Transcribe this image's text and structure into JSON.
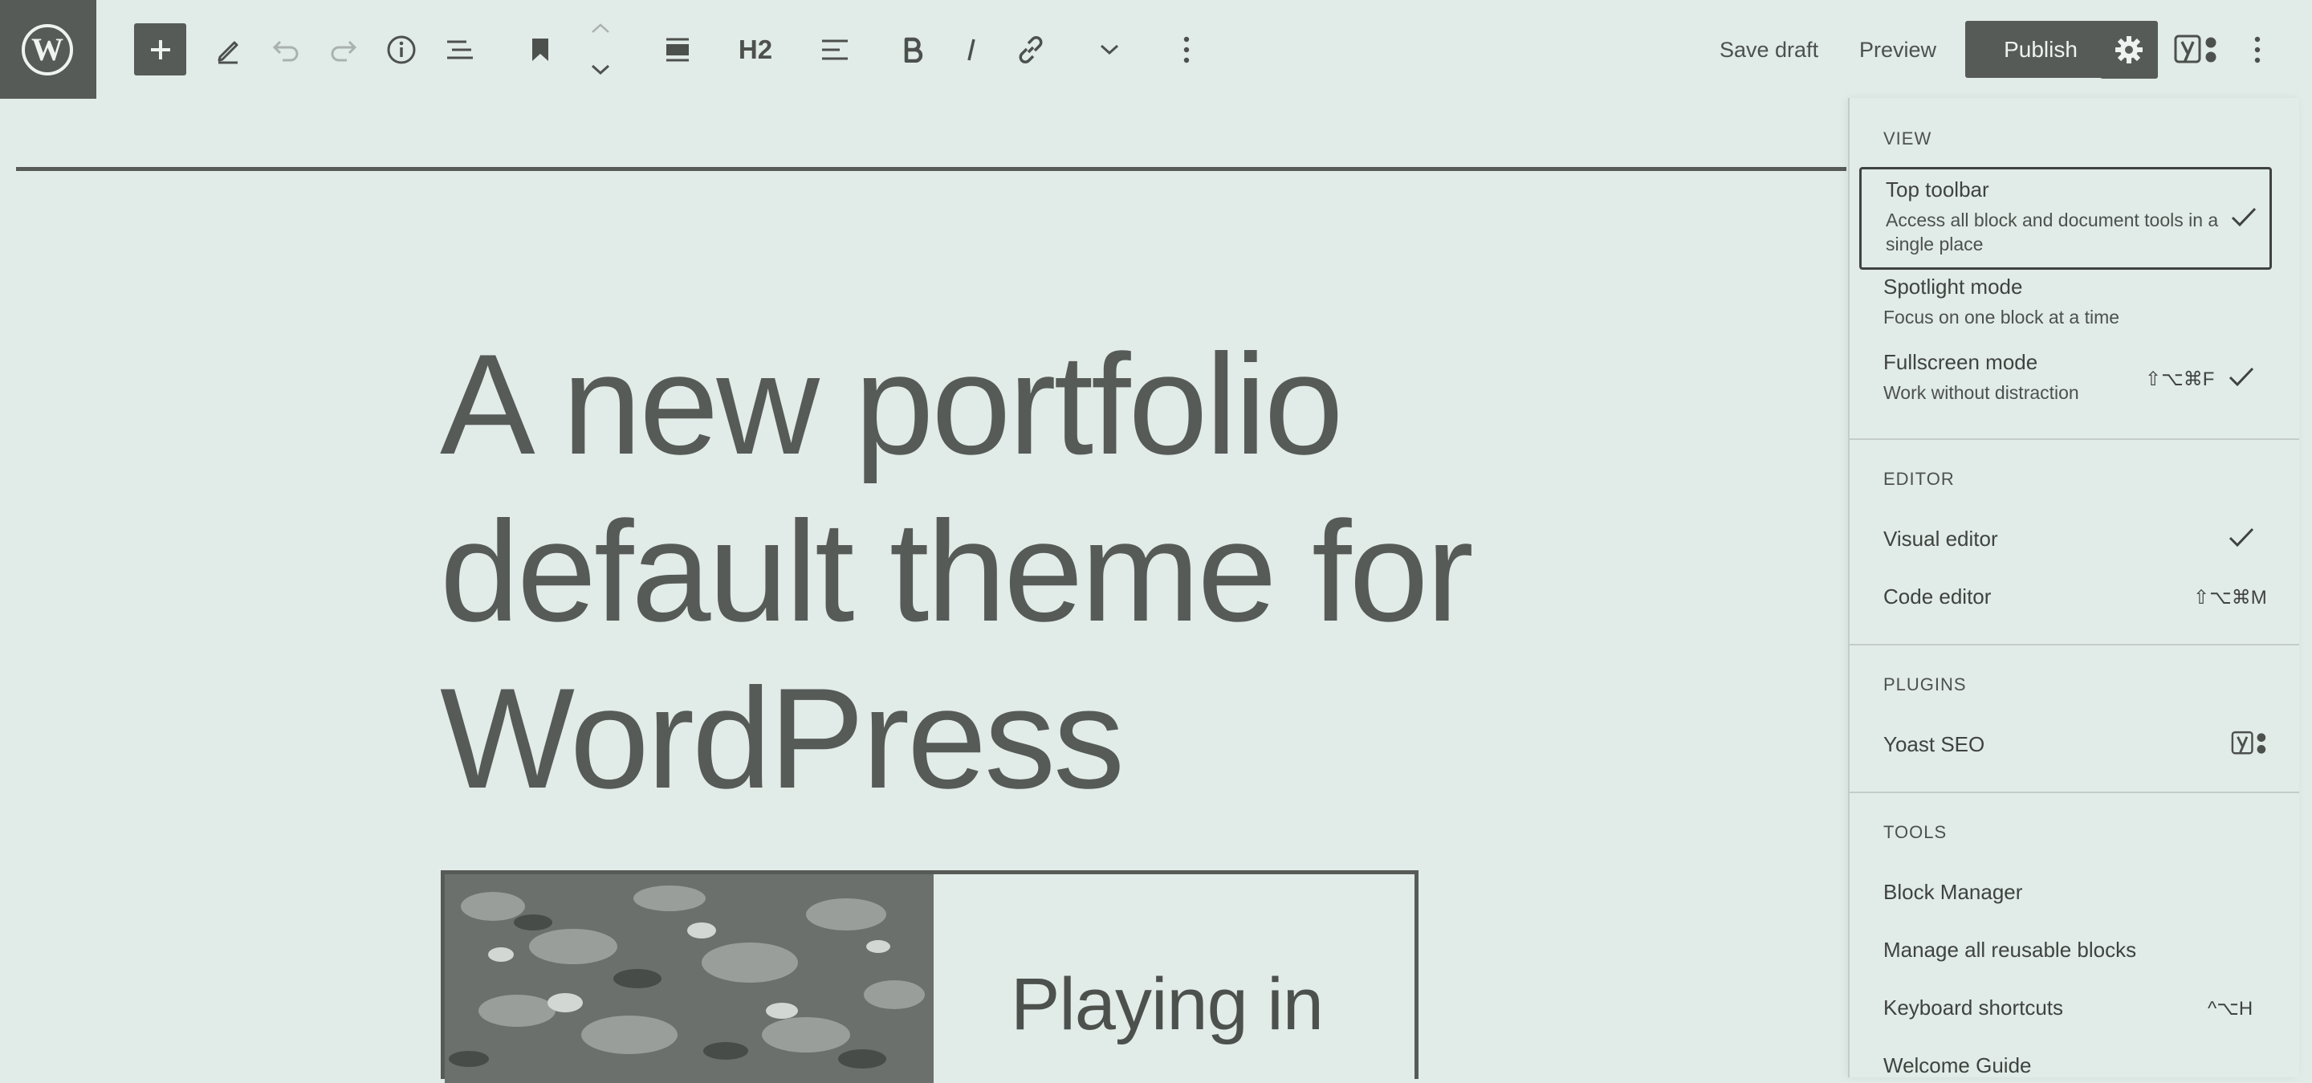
{
  "toolbar": {
    "save_draft": "Save draft",
    "preview": "Preview",
    "publish": "Publish",
    "heading_level": "H2"
  },
  "post": {
    "title": "A new portfolio default theme for WordPress",
    "media_text": "Playing in"
  },
  "menu": {
    "view": {
      "label": "VIEW",
      "items": [
        {
          "title": "Top toolbar",
          "desc": "Access all block and document tools in a single place",
          "checked": true,
          "shortcut": ""
        },
        {
          "title": "Spotlight mode",
          "desc": "Focus on one block at a time",
          "checked": false,
          "shortcut": ""
        },
        {
          "title": "Fullscreen mode",
          "desc": "Work without distraction",
          "checked": true,
          "shortcut": "⇧⌥⌘F"
        }
      ]
    },
    "editor": {
      "label": "EDITOR",
      "items": [
        {
          "title": "Visual editor",
          "checked": true,
          "shortcut": ""
        },
        {
          "title": "Code editor",
          "checked": false,
          "shortcut": "⇧⌥⌘M"
        }
      ]
    },
    "plugins": {
      "label": "PLUGINS",
      "items": [
        {
          "title": "Yoast SEO",
          "icon": "yoast-icon"
        }
      ]
    },
    "tools": {
      "label": "TOOLS",
      "items": [
        {
          "title": "Block Manager",
          "shortcut": ""
        },
        {
          "title": "Manage all reusable blocks",
          "shortcut": ""
        },
        {
          "title": "Keyboard shortcuts",
          "shortcut": "^⌥H"
        },
        {
          "title": "Welcome Guide",
          "shortcut": ""
        }
      ]
    }
  },
  "colors": {
    "background": "#e1ebe8",
    "accent": "#575b57",
    "text": "#4d514e"
  }
}
